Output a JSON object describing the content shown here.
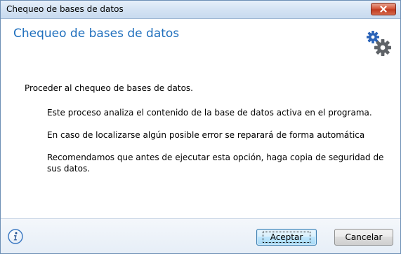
{
  "window": {
    "title": "Chequeo de bases de datos",
    "close_icon": "close-icon"
  },
  "header": {
    "heading": "Chequeo de bases de datos",
    "icon": "gears-icon"
  },
  "content": {
    "intro": "Proceder al chequeo de bases de datos.",
    "paragraphs": [
      "Este proceso analiza el contenido de la base de datos activa en el programa.",
      "En caso de localizarse algún posible error se reparará de forma automática",
      "Recomendamos que antes de ejecutar esta opción, haga copia de seguridad de sus datos."
    ]
  },
  "footer": {
    "info_icon": "info-icon",
    "accept_label": "Aceptar",
    "cancel_label": "Cancelar"
  },
  "colors": {
    "heading": "#1f6fbd",
    "close_button": "#c9462b",
    "gear_blue": "#2a63b8",
    "gear_gray": "#5f6368"
  }
}
